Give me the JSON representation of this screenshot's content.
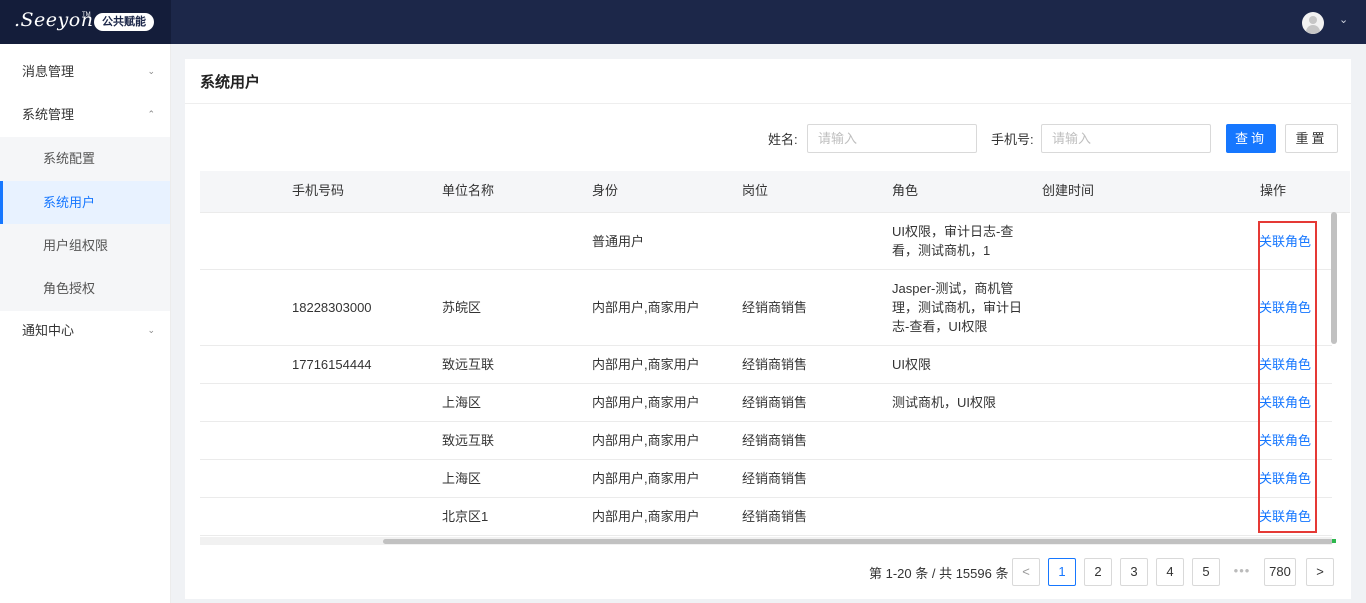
{
  "header": {
    "logo_text": ".Seeyon",
    "logo_tm": "TM",
    "logo_badge": "公共赋能",
    "caret": "⌄"
  },
  "sidebar": {
    "groups": [
      {
        "label": "消息管理",
        "chevron": "⌄"
      },
      {
        "label": "系统管理",
        "chevron": "⌃"
      },
      {
        "label": "通知中心",
        "chevron": "⌄"
      }
    ],
    "items": [
      {
        "label": "系统配置",
        "active": false
      },
      {
        "label": "系统用户",
        "active": true
      },
      {
        "label": "用户组权限",
        "active": false
      },
      {
        "label": "角色授权",
        "active": false
      }
    ]
  },
  "page": {
    "title": "系统用户"
  },
  "filters": {
    "name_label": "姓名:",
    "name_placeholder": "请输入",
    "name_value": "",
    "phone_label": "手机号:",
    "phone_placeholder": "请输入",
    "phone_value": "",
    "search_button": "查询",
    "reset_button": "重置"
  },
  "table": {
    "columns": [
      "手机号码",
      "单位名称",
      "身份",
      "岗位",
      "角色",
      "创建时间",
      "操作"
    ],
    "rows": [
      {
        "phone": "",
        "unit": "",
        "identity": "普通用户",
        "position": "",
        "roles": [
          "UI权限，审计日志-查",
          "看，测试商机，1"
        ],
        "created": "",
        "action": "关联角色"
      },
      {
        "phone": "18228303000",
        "unit": "苏皖区",
        "identity": "内部用户,商家用户",
        "position": "经销商销售",
        "roles": [
          "Jasper-测试，商机管",
          "理，测试商机，审计日",
          "志-查看，UI权限"
        ],
        "created": "",
        "action": "关联角色"
      },
      {
        "phone": "17716154444",
        "unit": "致远互联",
        "identity": "内部用户,商家用户",
        "position": "经销商销售",
        "roles": [
          "UI权限"
        ],
        "created": "",
        "action": "关联角色"
      },
      {
        "phone": "",
        "unit": "上海区",
        "identity": "内部用户,商家用户",
        "position": "经销商销售",
        "roles": [
          "测试商机，UI权限"
        ],
        "created": "",
        "action": "关联角色"
      },
      {
        "phone": "",
        "unit": "致远互联",
        "identity": "内部用户,商家用户",
        "position": "经销商销售",
        "roles": [],
        "created": "",
        "action": "关联角色"
      },
      {
        "phone": "",
        "unit": "上海区",
        "identity": "内部用户,商家用户",
        "position": "经销商销售",
        "roles": [],
        "created": "",
        "action": "关联角色"
      },
      {
        "phone": "",
        "unit": "北京区1",
        "identity": "内部用户,商家用户",
        "position": "经销商销售",
        "roles": [],
        "created": "",
        "action": "关联角色"
      }
    ]
  },
  "pagination": {
    "summary": "第 1-20 条 / 共 15596 条",
    "prev": "<",
    "next": ">",
    "pages": [
      "1",
      "2",
      "3",
      "4",
      "5"
    ],
    "ellipsis": "•••",
    "last_page": "780",
    "current_page": "1"
  },
  "colors": {
    "header_bg": "#1c2749",
    "primary": "#1677ff",
    "highlight": "#e53935"
  }
}
